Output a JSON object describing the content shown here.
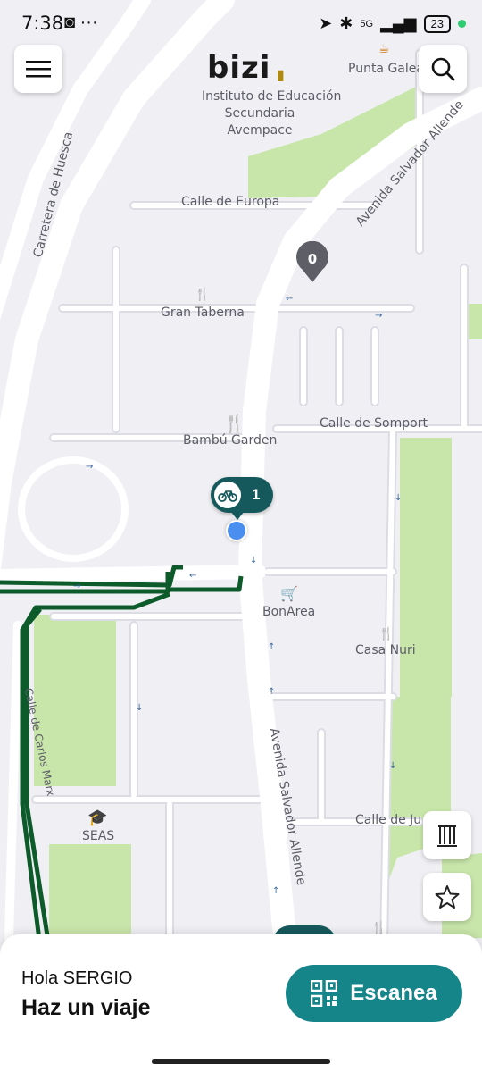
{
  "status_bar": {
    "time": "7:38",
    "left_icons": "◙ ···",
    "network": "5G",
    "battery": "23"
  },
  "header": {
    "menu_icon": "hamburger-menu-icon",
    "search_icon": "search-icon",
    "logo_text": "bizi"
  },
  "map": {
    "street_labels": {
      "carretera": "Carretera de Huesca",
      "avenida_top": "Avenida Salvador Allende",
      "avenida_bottom": "Avenida Salvador Allende",
      "europa": "Calle de Europa",
      "somport": "Calle de Somport",
      "calle_ju": "Calle de Ju",
      "carlos_marx": "Calle de Carlos Marx"
    },
    "poi_labels": {
      "punta": "Punta Galea",
      "instituto_1": "Instituto de Educación",
      "instituto_2": "Secundaria",
      "instituto_3": "Avempace",
      "gran_taberna": "Gran Taberna",
      "bambu": "Bambú Garden",
      "bonarea": "BonArea",
      "casa_nuri": "Casa Nuri",
      "seas": "SEAS"
    },
    "station_marker_empty": "0",
    "station_marker_bikes": "1"
  },
  "side_buttons": {
    "monument_icon": "monument-icon",
    "favorites_icon": "star-icon"
  },
  "bottom_panel": {
    "greeting": "Hola SERGIO",
    "call_to_action": "Haz un viaje",
    "scan_button": "Escanea"
  },
  "colors": {
    "map_bg": "#f0f0f4",
    "road": "#ffffff",
    "park": "#c5e3a6",
    "route": "#0d5a2a",
    "station_marker": "#16595c",
    "accent": "#16858a",
    "location": "#4a8ff0"
  }
}
